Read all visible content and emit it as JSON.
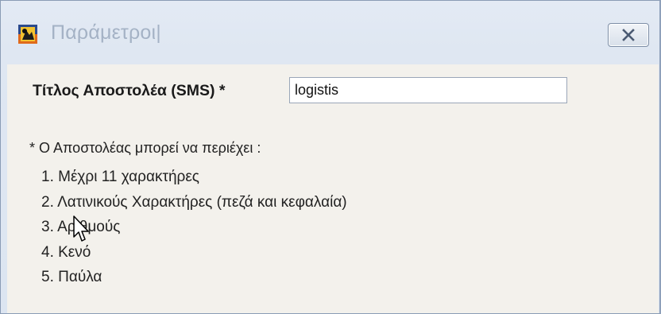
{
  "window": {
    "title": "Παράμετροι|"
  },
  "form": {
    "sender_label": "Τίτλος Αποστολέα (SMS) *",
    "sender_value": "logistis"
  },
  "note": {
    "heading": "* Ο Αποστολέας μπορεί να περιέχει :",
    "rules": [
      "1. Μέχρι 11 χαρακτήρες",
      "2. Λατινικούς Χαρακτήρες (πεζά και κεφαλαία)",
      "3. Αριθμούς",
      "4. Κενό",
      "5. Παύλα"
    ]
  },
  "icons": {
    "app": "app-icon",
    "close": "close-icon",
    "cursor": "mouse-cursor-icon"
  },
  "colors": {
    "title_text": "#a4b2c5",
    "client_background": "#f3f1ec",
    "frame": "#dfe7f2"
  }
}
